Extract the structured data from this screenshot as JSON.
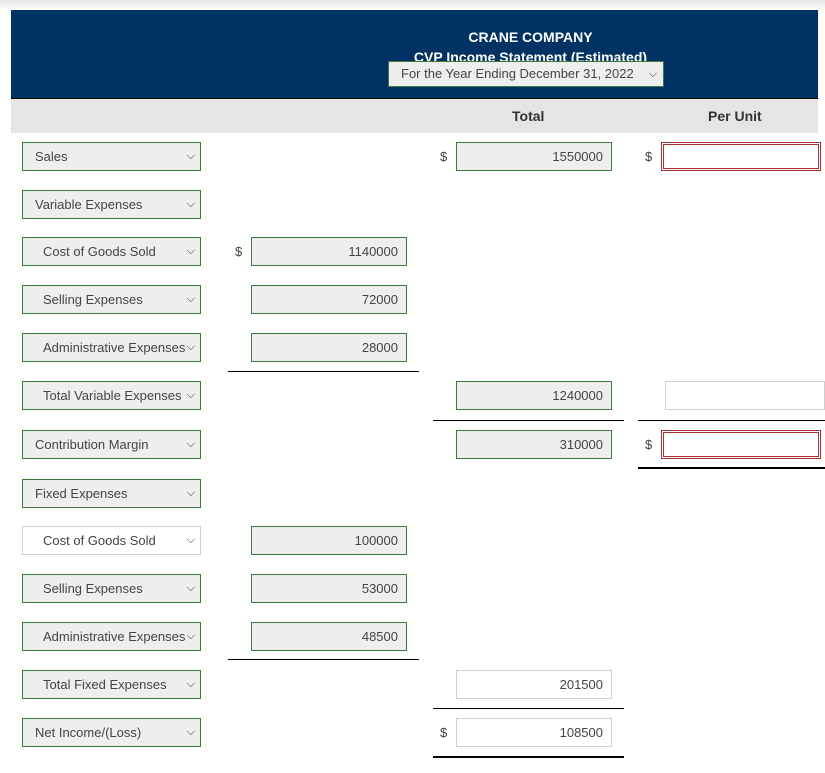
{
  "header": {
    "company": "CRANE COMPANY",
    "statement": "CVP Income Statement (Estimated)",
    "period": "For the Year Ending December 31, 2022"
  },
  "columns": {
    "total": "Total",
    "per_unit": "Per Unit"
  },
  "currency_symbol": "$",
  "rows": [
    {
      "label": "Sales",
      "col1": null,
      "total": "1550000",
      "per_unit": ""
    },
    {
      "label": "Variable Expenses"
    },
    {
      "label": "Cost of Goods Sold",
      "col1": "1140000"
    },
    {
      "label": "Selling Expenses",
      "col1": "72000"
    },
    {
      "label": "Administrative Expenses",
      "col1": "28000"
    },
    {
      "label": "Total Variable Expenses",
      "total": "1240000",
      "per_unit": ""
    },
    {
      "label": "Contribution Margin",
      "total": "310000",
      "per_unit": ""
    },
    {
      "label": "Fixed Expenses"
    },
    {
      "label": "Cost of Goods Sold",
      "col1": "100000"
    },
    {
      "label": "Selling Expenses",
      "col1": "53000"
    },
    {
      "label": "Administrative Expenses",
      "col1": "48500"
    },
    {
      "label": "Total Fixed Expenses",
      "total": "201500"
    },
    {
      "label": "Net Income/(Loss)",
      "total": "108500"
    }
  ],
  "icons": {
    "dropdown": "chevron-down-icon"
  },
  "colors": {
    "banner": "#003263",
    "valid_border": "#3b7a3b",
    "error_border": "#a83232",
    "header_row": "#e5e5e5"
  }
}
